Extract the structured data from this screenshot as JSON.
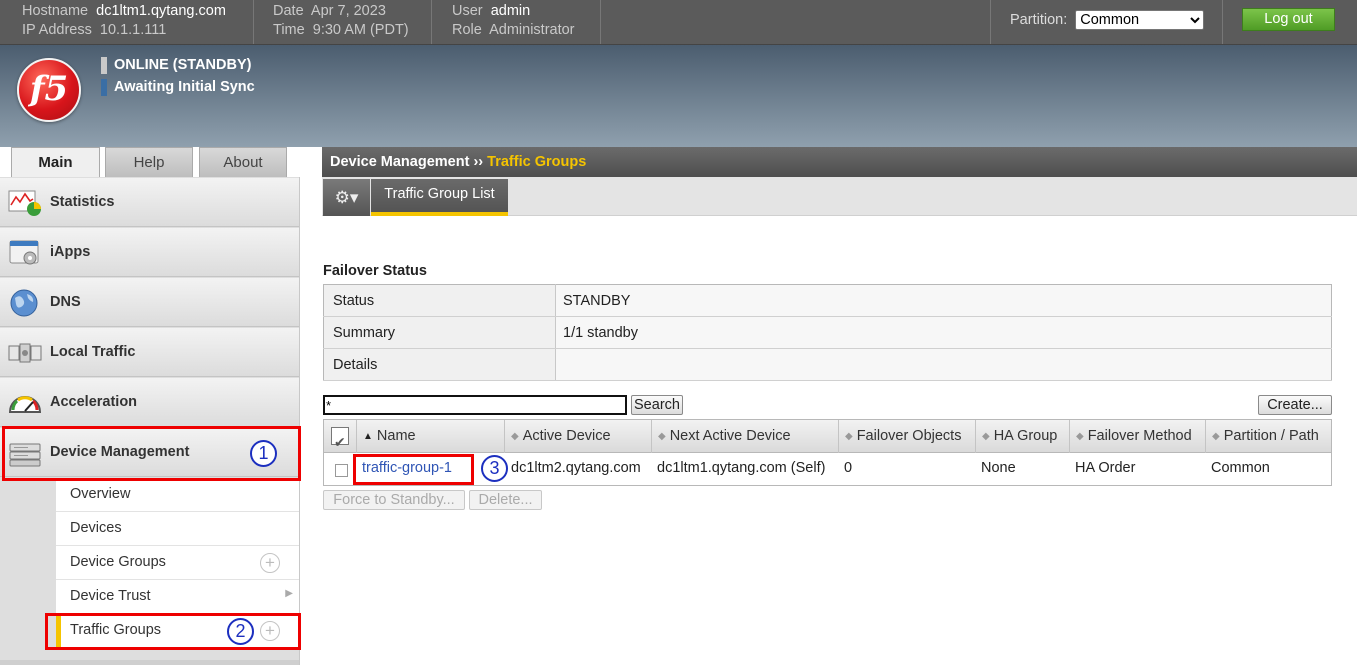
{
  "topbar": {
    "hostname_label": "Hostname",
    "hostname": "dc1ltm1.qytang.com",
    "ip_label": "IP Address",
    "ip": "10.1.1.111",
    "date_label": "Date",
    "date": "Apr 7, 2023",
    "time_label": "Time",
    "time": "9:30 AM (PDT)",
    "user_label": "User",
    "user": "admin",
    "role_label": "Role",
    "role": "Administrator",
    "partition_label": "Partition:",
    "partition_value": "Common",
    "logout_label": "Log out"
  },
  "header": {
    "logo_text": "f5",
    "status_online": "ONLINE (STANDBY)",
    "status_sync": "Awaiting Initial Sync"
  },
  "tabs": [
    {
      "label": "Main",
      "active": true
    },
    {
      "label": "Help",
      "active": false
    },
    {
      "label": "About",
      "active": false
    }
  ],
  "leftnav": {
    "items": [
      {
        "label": "Statistics",
        "icon": "statistics-icon"
      },
      {
        "label": "iApps",
        "icon": "iapps-icon"
      },
      {
        "label": "DNS",
        "icon": "dns-globe-icon"
      },
      {
        "label": "Local Traffic",
        "icon": "local-traffic-icon"
      },
      {
        "label": "Acceleration",
        "icon": "acceleration-gauge-icon"
      },
      {
        "label": "Device Management",
        "icon": "device-management-icon"
      }
    ],
    "subitems": [
      {
        "label": "Overview"
      },
      {
        "label": "Devices"
      },
      {
        "label": "Device Groups"
      },
      {
        "label": "Device Trust"
      },
      {
        "label": "Traffic Groups"
      }
    ],
    "plus_glyph": "+",
    "chevron_glyph": "▶"
  },
  "annotations": {
    "one": "1",
    "two": "2",
    "three": "3"
  },
  "breadcrumb": {
    "section": "Device Management",
    "separator": "››",
    "current": "Traffic Groups"
  },
  "subtab": {
    "label": "Traffic Group List",
    "gear_glyph": "⚙▾"
  },
  "failover": {
    "title": "Failover Status",
    "rows": [
      {
        "key": "Status",
        "value": "STANDBY"
      },
      {
        "key": "Summary",
        "value": "1/1 standby"
      },
      {
        "key": "Details",
        "value": ""
      }
    ]
  },
  "search": {
    "value": "*",
    "button": "Search",
    "create_button": "Create..."
  },
  "list": {
    "columns": [
      "Name",
      "Active Device",
      "Next Active Device",
      "Failover Objects",
      "HA Group",
      "Failover Method",
      "Partition / Path"
    ],
    "sort_arrow": "▲",
    "unsorted_arrow": "◆",
    "rows": [
      {
        "name": "traffic-group-1",
        "active_device": "dc1ltm2.qytang.com",
        "next_active_device": "dc1ltm1.qytang.com (Self)",
        "failover_objects": "0",
        "ha_group": "None",
        "failover_method": "HA Order",
        "partition": "Common"
      }
    ]
  },
  "actions": {
    "force_standby": "Force to Standby...",
    "delete": "Delete..."
  },
  "colors": {
    "accent_yellow": "#f5c400",
    "logout_green": "#5aa82e",
    "annotation_red": "#e00000",
    "annotation_blue": "#1c2fbf",
    "link_blue": "#2f55b5"
  }
}
